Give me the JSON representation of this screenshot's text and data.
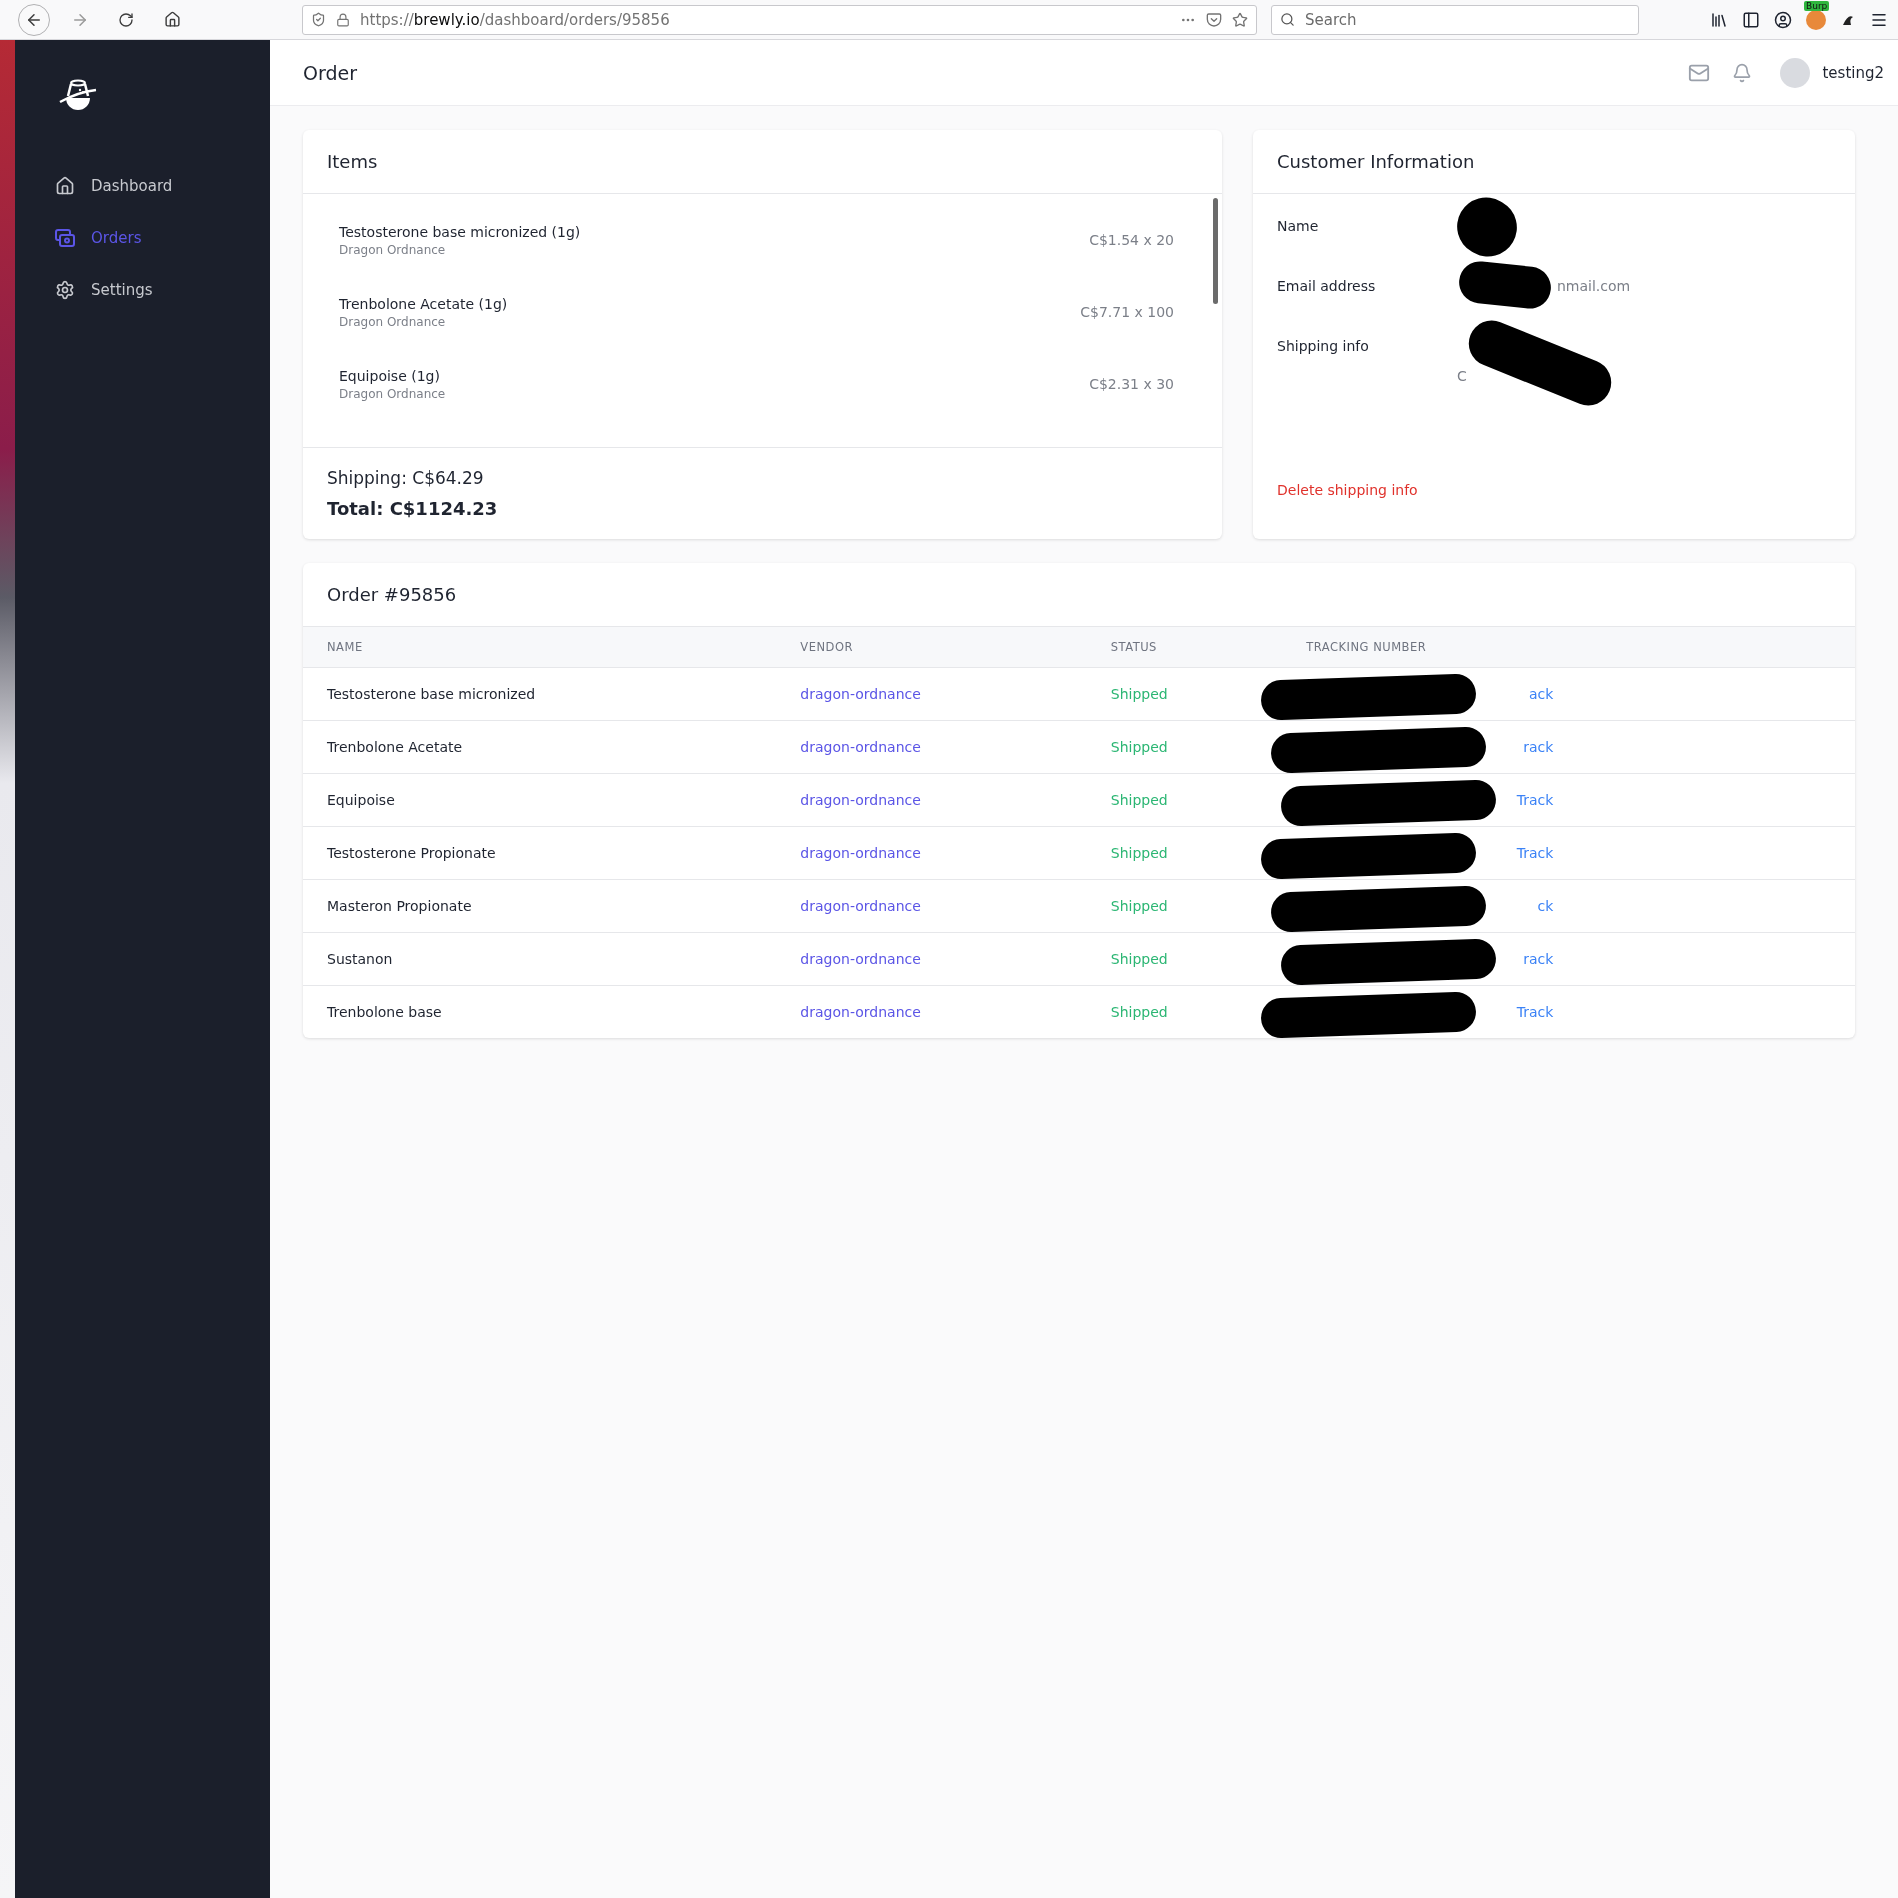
{
  "browser": {
    "url": "https://**brewly.io**/dashboard/orders/95856",
    "search_placeholder": "Search",
    "extension_badge": "Burp"
  },
  "sidebar": {
    "items": [
      {
        "label": "Dashboard",
        "selected": false
      },
      {
        "label": "Orders",
        "selected": true
      },
      {
        "label": "Settings",
        "selected": false
      }
    ]
  },
  "header": {
    "title": "Order",
    "user": "testing2"
  },
  "items_card": {
    "title": "Items",
    "items": [
      {
        "name": "Testosterone base micronized (1g)",
        "vendor": "Dragon Ordnance",
        "price": "C$1.54 x 20"
      },
      {
        "name": "Trenbolone Acetate (1g)",
        "vendor": "Dragon Ordnance",
        "price": "C$7.71 x 100"
      },
      {
        "name": "Equipoise (1g)",
        "vendor": "Dragon Ordnance",
        "price": "C$2.31 x 30"
      }
    ],
    "shipping": "Shipping: C$64.29",
    "total": "Total: C$1124.23"
  },
  "customer": {
    "title": "Customer Information",
    "fields": [
      {
        "label": "Name",
        "redacted": true
      },
      {
        "label": "Email address",
        "redacted": true,
        "visible_lines": [
          "nmail.com"
        ]
      },
      {
        "label": "Shipping info",
        "redacted": true,
        "visible_lines": [
          "C"
        ]
      }
    ],
    "delete_link": "Delete shipping info"
  },
  "order_table": {
    "title": "Order #95856",
    "columns": [
      "NAME",
      "VENDOR",
      "STATUS",
      "TRACKING NUMBER"
    ],
    "rows": [
      {
        "name": "Testosterone base micronized",
        "vendor": "dragon-ordnance",
        "status": "Shipped",
        "tracking_redacted": true,
        "tracking_link": "ack"
      },
      {
        "name": "Trenbolone Acetate",
        "vendor": "dragon-ordnance",
        "status": "Shipped",
        "tracking_redacted": true,
        "tracking_link": "rack"
      },
      {
        "name": "Equipoise",
        "vendor": "dragon-ordnance",
        "status": "Shipped",
        "tracking_redacted": true,
        "tracking_link": "Track"
      },
      {
        "name": "Testosterone Propionate",
        "vendor": "dragon-ordnance",
        "status": "Shipped",
        "tracking_redacted": true,
        "tracking_link": "Track"
      },
      {
        "name": "Masteron Propionate",
        "vendor": "dragon-ordnance",
        "status": "Shipped",
        "tracking_redacted": true,
        "tracking_link": "ck"
      },
      {
        "name": "Sustanon",
        "vendor": "dragon-ordnance",
        "status": "Shipped",
        "tracking_redacted": true,
        "tracking_link": "rack"
      },
      {
        "name": "Trenbolone base",
        "vendor": "dragon-ordnance",
        "status": "Shipped",
        "tracking_redacted": true,
        "tracking_link": "Track"
      }
    ]
  }
}
